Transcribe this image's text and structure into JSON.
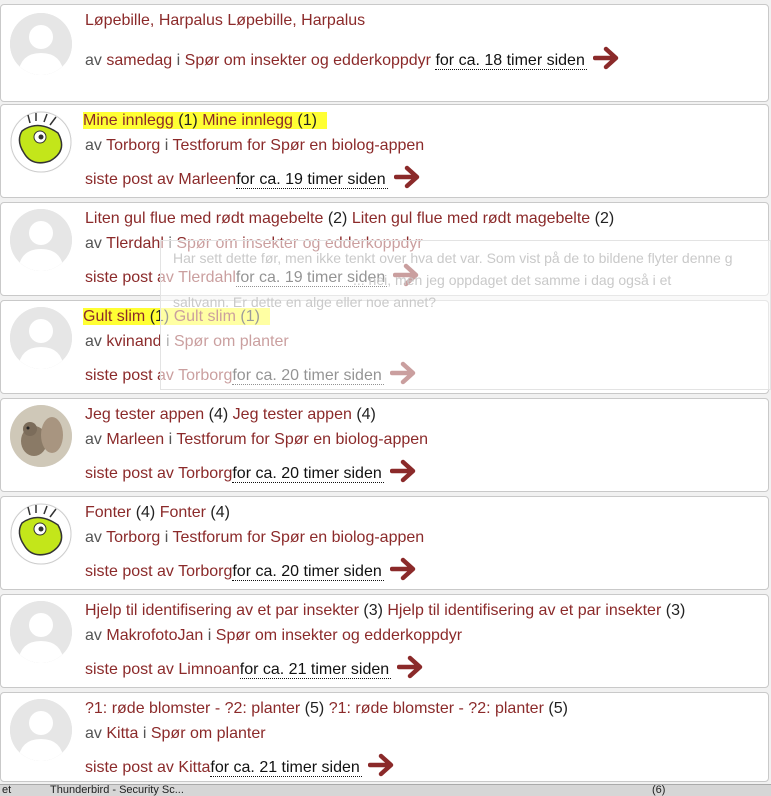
{
  "labels": {
    "by": "av",
    "in": "i",
    "last_post_by": "siste post av"
  },
  "topics": [
    {
      "title": "Løpebille, Harpalus",
      "count": "",
      "title2": "Løpebille, Harpalus",
      "author": "samedag",
      "forum": "Spør om insekter og edderkoppdyr",
      "last_poster": "",
      "time": "for ca. 18 timer siden",
      "avatar": "default-avatar",
      "highlight": false
    },
    {
      "title": "Mine innlegg",
      "count": "(1)",
      "title2": "Mine innlegg",
      "count2": "(1)",
      "author": "Torborg",
      "forum": "Testforum for Spør en biolog-appen",
      "last_poster": "Marleen",
      "time": "for ca. 19 timer siden",
      "avatar": "green-creature-avatar",
      "highlight": true
    },
    {
      "title": "Liten gul flue med rødt magebelte",
      "count": "(2)",
      "title2": "Liten gul flue med rødt magebelte",
      "count2": "(2)",
      "author": "Tlerdahl",
      "forum": "Spør om insekter og edderkoppdyr",
      "last_poster": "Tlerdahl",
      "time": "for ca. 19 timer siden",
      "avatar": "default-avatar",
      "highlight": false
    },
    {
      "title": "Gult slim",
      "count": "(1)",
      "title2": "Gult slim",
      "count2": "(1)",
      "author": "kvinand",
      "forum": "Spør om planter",
      "last_poster": "Torborg",
      "time": "for ca. 20 timer siden",
      "avatar": "default-avatar",
      "highlight": true
    },
    {
      "title": "Jeg tester appen",
      "count": "(4)",
      "title2": "Jeg tester appen",
      "count2": "(4)",
      "author": "Marleen",
      "forum": "Testforum for Spør en biolog-appen",
      "last_poster": "Torborg",
      "time": "for ca. 20 timer siden",
      "avatar": "squirrel-photo-avatar",
      "highlight": false
    },
    {
      "title": "Fonter",
      "count": "(4)",
      "title2": "Fonter",
      "count2": "(4)",
      "author": "Torborg",
      "forum": "Testforum for Spør en biolog-appen",
      "last_poster": "Torborg",
      "time": "for ca. 20 timer siden",
      "avatar": "green-creature-avatar",
      "highlight": false
    },
    {
      "title": "Hjelp til identifisering av et par insekter",
      "count": "(3)",
      "title2": "Hjelp til identifisering av et par insekter",
      "count2": "(3)",
      "author": "MakrofotoJan",
      "forum": "Spør om insekter og edderkoppdyr",
      "last_poster": "Limnoan",
      "time": "for ca. 21 timer siden",
      "avatar": "default-avatar",
      "highlight": false
    },
    {
      "title": "?1: røde blomster - ?2: planter",
      "count": "(5)",
      "title2": "?1: røde blomster - ?2: planter",
      "count2": "(5)",
      "author": "Kitta",
      "forum": "Spør om planter",
      "last_poster": "Kitta",
      "time": "for ca. 21 timer siden",
      "avatar": "default-avatar",
      "highlight": false
    }
  ],
  "ghost_preview": {
    "line1": "Har sett dette før, men ikke tenkt over hva det var. Som vist på de to bildene flyter denne g",
    "line2": "... nei, men jeg oppdaget det samme i dag også i et",
    "line3": "saltvann. Er dette en alge eller noe annet?"
  },
  "taskbar": {
    "item1": "et",
    "item2": "Thunderbird - Security Sc...",
    "count": "(6)"
  },
  "colors": {
    "link": "#8b2a2a",
    "arrow": "#8b2a2a",
    "highlight": "#ffff33"
  }
}
